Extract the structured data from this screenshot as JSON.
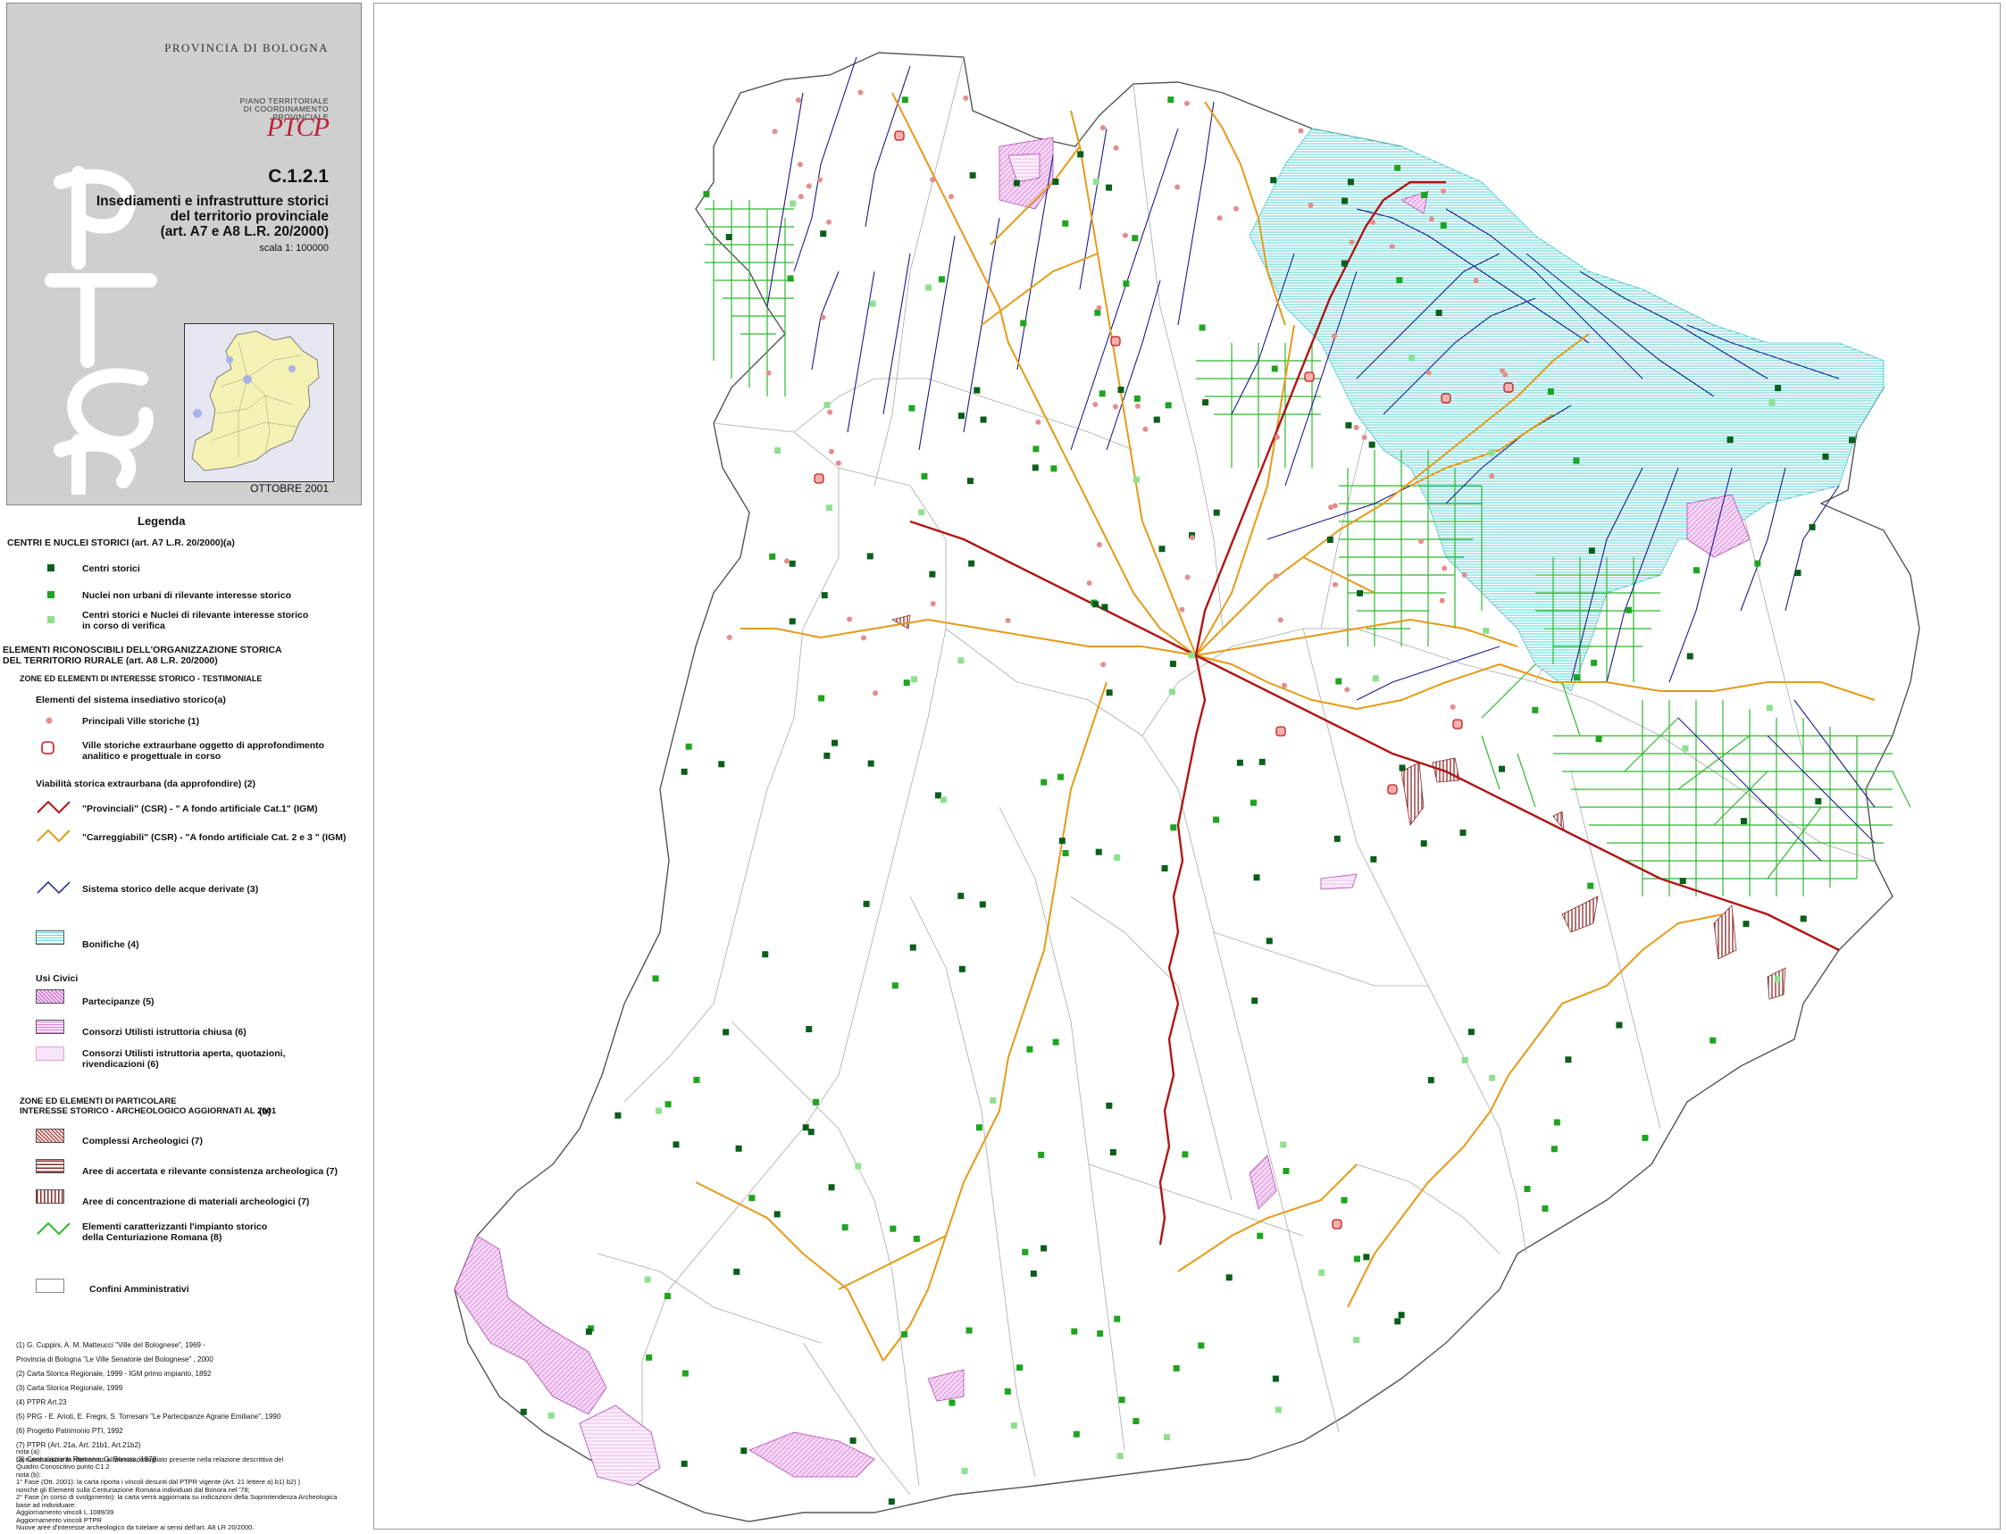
{
  "title_block": {
    "province": "PROVINCIA DI BOLOGNA",
    "plan_name_lines": [
      "PIANO TERRITORIALE",
      "DI COORDINAMENTO",
      "PROVINCIALE"
    ],
    "logo_text": "PTCP",
    "map_code": "C.1.2.1",
    "title_lines": [
      "Insediamenti e infrastrutture storici",
      "del territorio provinciale",
      "(art. A7 e A8 L.R. 20/2000)"
    ],
    "scale": "scala 1: 100000",
    "date": "OTTOBRE 2001"
  },
  "legend": {
    "heading": "Legenda",
    "section_a_title": "CENTRI E NUCLEI STORICI (art. A7 L.R. 20/2000)",
    "section_a_note": "(a)",
    "centri_storici": "Centri storici",
    "nuclei": "Nuclei non urbani di rilevante interesse storico",
    "in_verifica_1": "Centri storici e Nuclei di rilevante interesse storico",
    "in_verifica_2": "in corso di verifica",
    "section_b_title_1": "ELEMENTI RICONOSCIBILI DELL'ORGANIZZAZIONE STORICA",
    "section_b_title_2": "DEL TERRITORIO RURALE (art. A8 L.R. 20/2000)",
    "zone_testimoniale": "ZONE ED ELEMENTI DI INTERESSE STORICO - TESTIMONIALE",
    "sistema_insediativo": "Elementi del sistema insediativo storico",
    "sistema_note": "(a)",
    "ville": "Principali Ville storiche (1)",
    "ville_extra_1": "Ville storiche extraurbane oggetto di approfondimento",
    "ville_extra_2": "analitico e progettuale in corso",
    "viabilita": "Viabilità storica extraurbana  (da approfondire) (2)",
    "provinciali": "\"Provinciali\" (CSR) - \" A fondo artificiale Cat.1\" (IGM)",
    "carreggiabili": "\"Carreggiabili\" (CSR) - \"A fondo artificiale Cat. 2 e 3 \" (IGM)",
    "acque": "Sistema storico delle acque derivate (3)",
    "bonifiche": "Bonifiche (4)",
    "usi_civici": "Usi Civici",
    "partecipanze": "Partecipanze (5)",
    "consorzi_chiusa": "Consorzi Utilisti  istruttoria chiusa  (6)",
    "consorzi_aperta_1": "Consorzi Utilisti  istruttoria aperta, quotazioni,",
    "consorzi_aperta_2": "rivendicazioni (6)",
    "zone_particolare_1": "ZONE ED ELEMENTI DI PARTICOLARE",
    "zone_particolare_2": "INTERESSE STORICO - ARCHEOLOGICO AGGIORNATI AL 2001",
    "zone_particolare_note": "(b)",
    "complessi": "Complessi Archeologici (7)",
    "aree_accertata": "Aree di accertata e rilevante consistenza archeologica (7)",
    "aree_concentrazione": "Aree di concentrazione di materiali archeologici (7)",
    "centuriazione_1": "Elementi caratterizzanti l'impianto storico",
    "centuriazione_2": "della Centuriazione Romana (8)",
    "confini": "Confini  Amministrativi",
    "sources": [
      "(1)  G. Cuppini, A. M. Matteucci \"Ville del Bolognese\", 1969 -",
      "        Provincia di Bologna \"Le Ville Senatorie del Bolognese\" , 2000",
      "(2) Carta Storica Regionale, 1999 - IGM primo impianto, 1892",
      "(3) Carta Storica Regionale, 1999",
      "(4) PTPR Art.23",
      "(5) PRG - E. Arioti, E. Fregni, S. Torresani \"Le Partecipanze Agrarie Emiliane\", 1990",
      "(6) Progetto Patrimonio PTI, 1992",
      "(7) PTPR (Art. 21a, Art. 21b1, Art.21b2)",
      "(8) Centuriazione Romana, G. Bonora, 1978"
    ],
    "notes": [
      "nota (a):",
      "La numerazione fa riferimento all'elenco dettagliato presente nella relazione descrittiva del",
      "Quadro Conoscitivo punto C1.2",
      "nota (b):",
      "1° Fase (Ott. 2001): la carta riporta i vincoli desunti dal PTPR vigente (Art. 21 lettere a) b1) b2) )",
      "nonché gli Elementi sulla Centuriazione Romana individuati dal Bonora nel '78;",
      "2° Fase (in corso di svolgimento): la carta verrà aggiornata su indicazioni della Soprintendenza Archeologica",
      "base ad individuare:",
      "Aggiornamento vincoli L.1089/39",
      "Aggiornamento vincoli PTPR",
      "Nuove aree d'interesse archeologico da tutelare ai sensi dell'art. A8 LR 20/2000."
    ]
  },
  "colors": {
    "centri": "#0b5e1a",
    "nuclei": "#1fa41f",
    "verifica": "#8ee08e",
    "ville": "#e58c8c",
    "provinciali": "#b21515",
    "carreggiabili": "#e69a17",
    "acque": "#1b1b8f",
    "bonifiche": "#64d6dc",
    "usi_civici": "#c85ec8",
    "centuriazione": "#2fb82f",
    "confini": "#9a9a9a",
    "archeo": "#8b2a2a"
  }
}
